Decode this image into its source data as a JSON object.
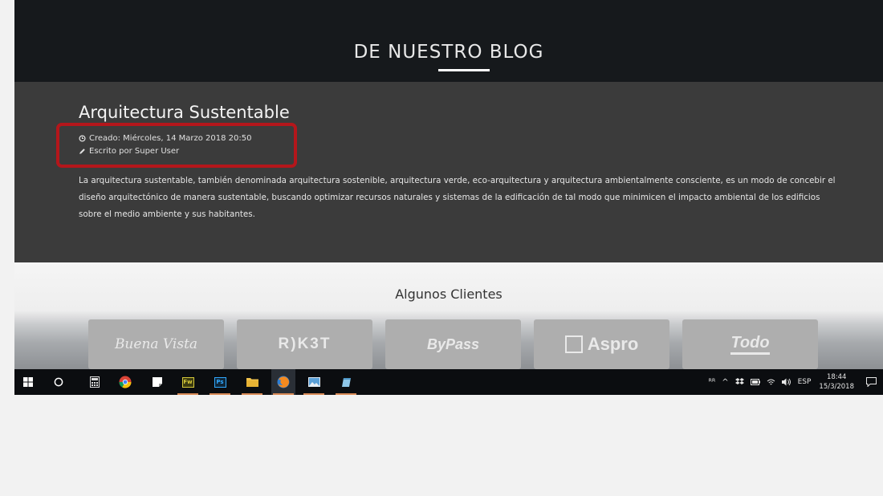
{
  "blog": {
    "title": "DE NUESTRO BLOG"
  },
  "article": {
    "title": "Arquitectura Sustentable",
    "created": "Creado: Miércoles, 14 Marzo 2018 20:50",
    "author": "Escrito por Super User",
    "body": "La arquitectura sustentable, también denominada arquitectura sostenible, arquitectura verde, eco-arquitectura y arquitectura ambientalmente consciente, es un modo de concebir el diseño arquitectónico de manera sustentable, buscando optimizar recursos naturales y sistemas de la edificación de tal modo que minimicen el impacto ambiental de los edificios sobre el medio ambiente y sus habitantes.",
    "highlight_color": "#b4161b"
  },
  "clients": {
    "title": "Algunos Clientes",
    "logos": [
      "Buena Vista",
      "R)K3T",
      "ByPass",
      "Aspro",
      "Todo"
    ]
  },
  "taskbar": {
    "apps": [
      {
        "name": "start-icon"
      },
      {
        "name": "search-icon"
      },
      {
        "name": "calculator-icon"
      },
      {
        "name": "chrome-icon"
      },
      {
        "name": "sticky-notes-icon"
      },
      {
        "name": "fireworks-icon",
        "label": "Fw"
      },
      {
        "name": "photoshop-icon",
        "label": "Ps"
      },
      {
        "name": "file-explorer-icon"
      },
      {
        "name": "firefox-icon"
      },
      {
        "name": "photos-icon"
      },
      {
        "name": "notepad-icon"
      }
    ],
    "tray": {
      "language": "ESP",
      "time": "18:44",
      "date": "15/3/2018"
    }
  }
}
